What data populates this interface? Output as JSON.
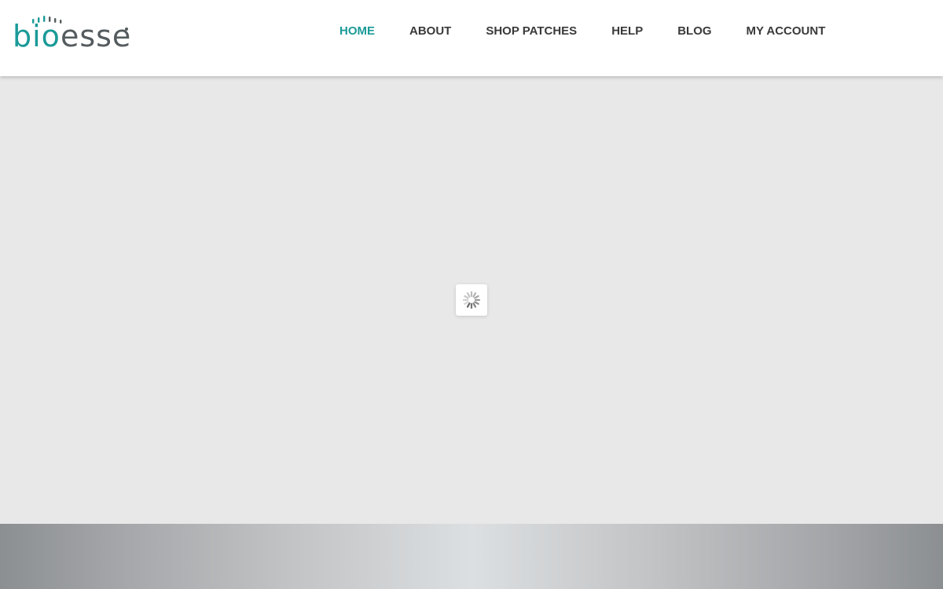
{
  "brand": {
    "name_part1": "bio",
    "name_part2": "esse",
    "accent_color": "#1a9a98",
    "text_color": "#555b5e"
  },
  "nav": {
    "items": [
      {
        "label": "HOME",
        "active": true
      },
      {
        "label": "ABOUT",
        "active": false
      },
      {
        "label": "SHOP PATCHES",
        "active": false
      },
      {
        "label": "HELP",
        "active": false
      },
      {
        "label": "BLOG",
        "active": false
      },
      {
        "label": "MY ACCOUNT",
        "active": false
      }
    ]
  },
  "main": {
    "loading_indicator": "spinner-icon",
    "background_color": "#e8e8e8"
  }
}
